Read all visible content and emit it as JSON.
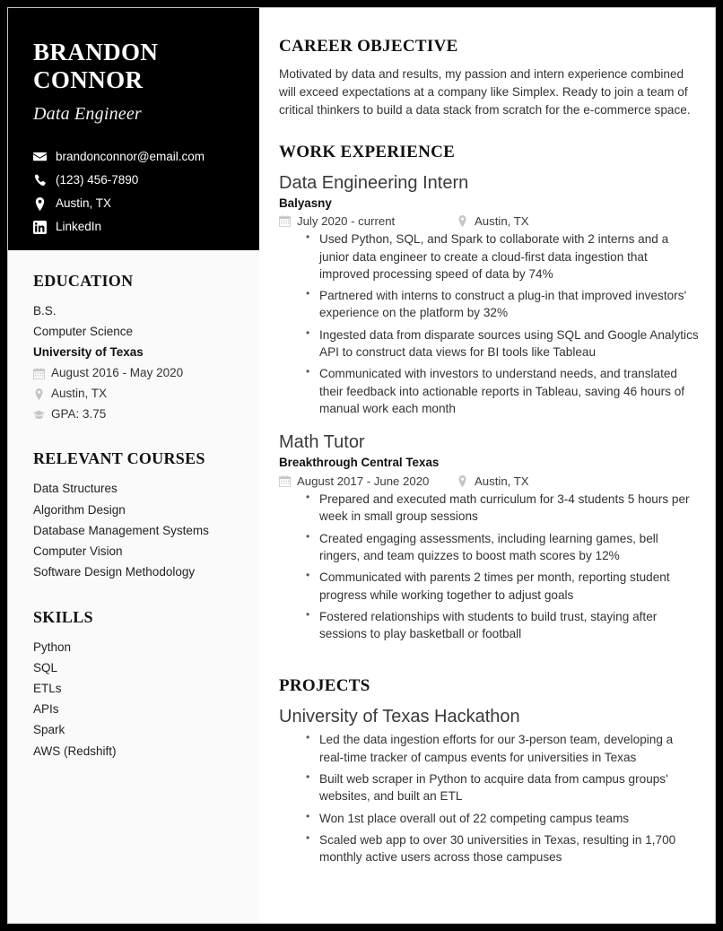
{
  "sidebar": {
    "name": "BRANDON CONNOR",
    "role": "Data Engineer",
    "contacts": [
      {
        "icon": "envelope-icon",
        "text": "brandonconnor@email.com"
      },
      {
        "icon": "phone-icon",
        "text": "(123) 456-7890"
      },
      {
        "icon": "map-pin-icon",
        "text": "Austin, TX"
      },
      {
        "icon": "linkedin-icon",
        "text": "LinkedIn"
      }
    ],
    "education": {
      "heading": "EDUCATION",
      "degree": "B.S.",
      "field": "Computer Science",
      "school": "University of Texas",
      "dates": "August 2016 - May 2020",
      "location": "Austin, TX",
      "gpa": "GPA: 3.75"
    },
    "courses": {
      "heading": "RELEVANT COURSES",
      "items": [
        "Data Structures",
        "Algorithm Design",
        "Database Management Systems",
        "Computer Vision",
        "Software Design Methodology"
      ]
    },
    "skills": {
      "heading": "SKILLS",
      "items": [
        "Python",
        "SQL",
        "ETLs",
        "APIs",
        "Spark",
        "AWS (Redshift)"
      ]
    }
  },
  "main": {
    "objective": {
      "heading": "CAREER OBJECTIVE",
      "text": "Motivated by data and results, my passion and intern experience combined will exceed expectations at a company like Simplex. Ready to join a team of critical thinkers to build a data stack from scratch for the e-commerce space."
    },
    "work": {
      "heading": "WORK EXPERIENCE",
      "entries": [
        {
          "title": "Data Engineering Intern",
          "org": "Balyasny",
          "dates": "July 2020 - current",
          "location": "Austin, TX",
          "bullets": [
            "Used Python, SQL, and Spark to collaborate with 2 interns and a junior data engineer to create a cloud-first data ingestion that improved processing speed of data by 74%",
            "Partnered with interns to construct a plug-in that improved investors' experience on the platform by 32%",
            "Ingested data from disparate sources using SQL and Google Analytics API to construct data views for BI tools like Tableau",
            "Communicated with investors to understand needs, and translated their feedback into actionable reports in Tableau, saving 46 hours of manual work each month"
          ]
        },
        {
          "title": "Math Tutor",
          "org": "Breakthrough Central Texas",
          "dates": "August 2017 - June 2020",
          "location": "Austin, TX",
          "bullets": [
            "Prepared and executed math curriculum for 3-4 students 5 hours per week in small group sessions",
            "Created engaging assessments, including learning games, bell ringers, and team quizzes to boost math scores by 12%",
            "Communicated with parents 2 times per month, reporting student progress while working together to adjust goals",
            "Fostered relationships with students to build trust, staying after sessions to play basketball or football"
          ]
        }
      ]
    },
    "projects": {
      "heading": "PROJECTS",
      "entries": [
        {
          "title": "University of Texas Hackathon",
          "bullets": [
            "Led the data ingestion efforts for our 3-person team, developing a real-time tracker of campus events for universities in Texas",
            "Built web scraper in Python to acquire data from campus groups' websites, and built an ETL",
            "Won 1st place overall out of 22 competing campus teams",
            "Scaled web app to over 30 universities in Texas, resulting in 1,700 monthly active users across those campuses"
          ]
        }
      ]
    }
  }
}
